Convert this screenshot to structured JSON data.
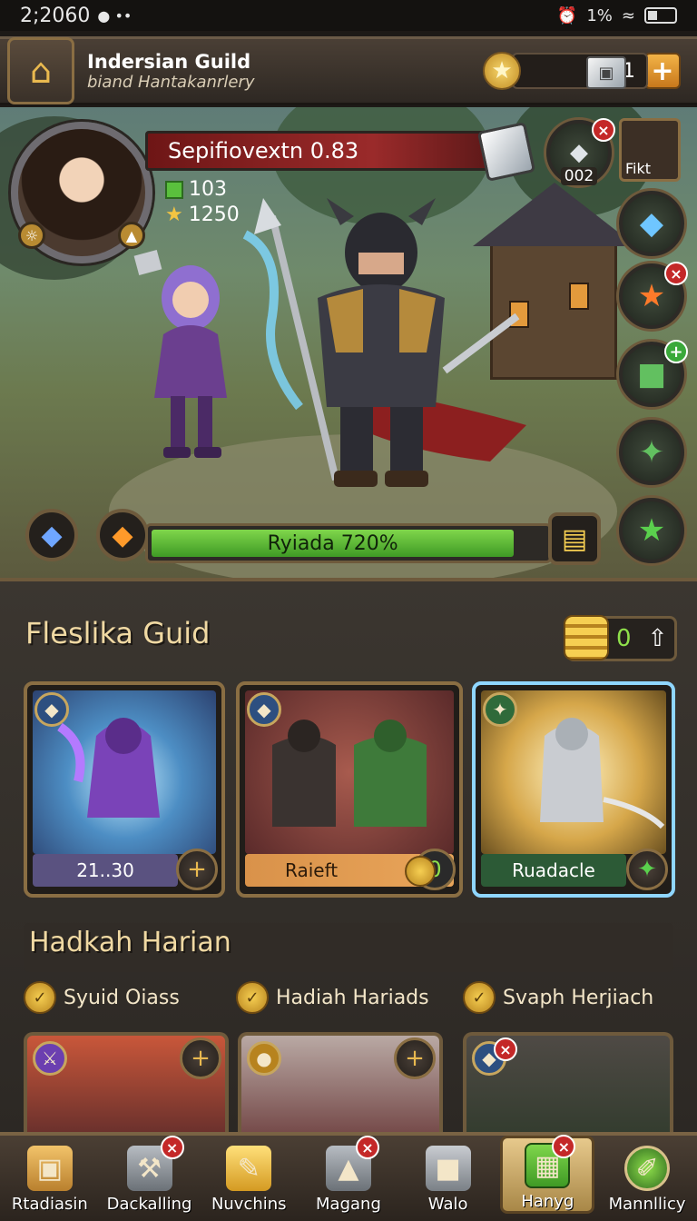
{
  "status_bar": {
    "time": "2;2060",
    "dots": "● ••",
    "battery_text": "1%",
    "icons": [
      "alarm-icon",
      "wifi-icon",
      "battery-icon"
    ]
  },
  "header": {
    "title": "Indersian Guild",
    "subtitle": "biand Hantakanrlery",
    "currency_value": "1"
  },
  "player": {
    "name_bar": "Sepifiovextn 0.83",
    "stat_1": "103",
    "stat_2": "1250",
    "rank_label": "002",
    "mini_tag": "Fikt"
  },
  "progress": {
    "label": "Ryiada 720%",
    "value": 0.92
  },
  "panel": {
    "title": "Fleslika Guid",
    "coin_value": "0",
    "cards": [
      {
        "footer": "21..30",
        "button_icon": "plus"
      },
      {
        "footer": "Raieft",
        "coin": "0"
      },
      {
        "footer": "Ruadacle"
      }
    ],
    "daily_title": "Hadkah Harian",
    "daily_tabs": [
      "Syuid Oiass",
      "Hadiah Hariads",
      "Svaph Herjiach"
    ]
  },
  "nav": [
    {
      "label": "Rtadiasin",
      "icon": "box-icon"
    },
    {
      "label": "Dackalling",
      "icon": "tools-icon"
    },
    {
      "label": "Nuvchins",
      "icon": "chest-icon"
    },
    {
      "label": "Magang",
      "icon": "helmet-icon"
    },
    {
      "label": "Walo",
      "icon": "armor-icon"
    },
    {
      "label": "Hanyg",
      "icon": "map-icon",
      "selected": true
    },
    {
      "label": "Mannllicy",
      "icon": "feather-icon"
    }
  ],
  "colors": {
    "accent": "#e9b94f",
    "progress_green": "#5ac03d",
    "name_red": "#9a2a2a",
    "frame_gold": "#8a6e43"
  }
}
